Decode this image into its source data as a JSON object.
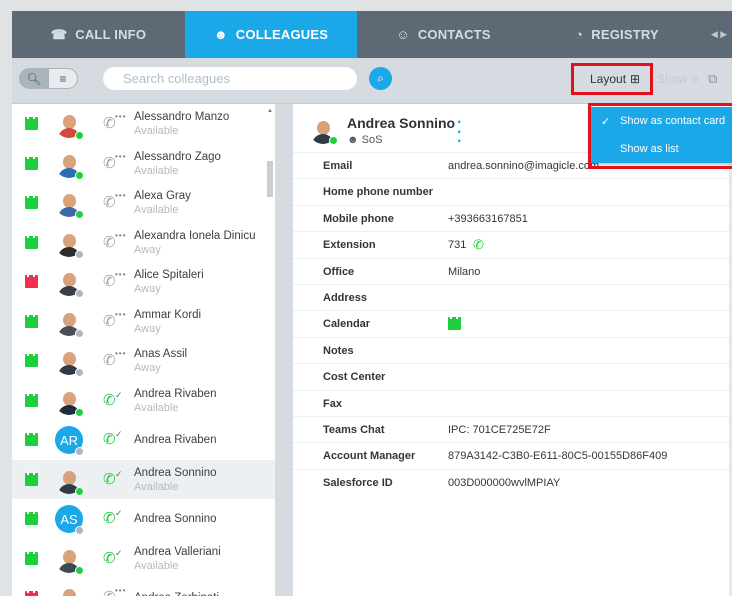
{
  "tabs": [
    {
      "label": "CALL INFO",
      "icon": "call-info-icon"
    },
    {
      "label": "COLLEAGUES",
      "icon": "colleagues-icon"
    },
    {
      "label": "CONTACTS",
      "icon": "contacts-icon"
    },
    {
      "label": "REGISTRY",
      "icon": "registry-icon"
    }
  ],
  "toolbar": {
    "search_placeholder": "Search colleagues",
    "layout_label": "Layout",
    "show_label": "Show"
  },
  "colleagues": [
    {
      "name": "Alessandro Manzo",
      "status": "Available",
      "calendar": "green",
      "presence": "green",
      "phone": "grey",
      "avatar": "photo",
      "shirt": "#d24a3a"
    },
    {
      "name": "Alessandro Zago",
      "status": "Available",
      "calendar": "green",
      "presence": "green",
      "phone": "grey",
      "avatar": "photo",
      "shirt": "#2a6fb2"
    },
    {
      "name": "Alexa Gray",
      "status": "Available",
      "calendar": "green",
      "presence": "green",
      "phone": "grey",
      "avatar": "photo",
      "shirt": "#3c6aa8"
    },
    {
      "name": "Alexandra Ionela Dinicu",
      "status": "Away",
      "calendar": "green",
      "presence": "grey",
      "phone": "grey",
      "avatar": "photo",
      "shirt": "#2c2c2c"
    },
    {
      "name": "Alice Spitaleri",
      "status": "Away",
      "calendar": "red",
      "presence": "grey",
      "phone": "grey",
      "avatar": "photo",
      "shirt": "#3a3f46"
    },
    {
      "name": "Ammar Kordi",
      "status": "Away",
      "calendar": "green",
      "presence": "grey",
      "phone": "grey",
      "avatar": "photo",
      "shirt": "#4b4f55"
    },
    {
      "name": "Anas Assil",
      "status": "Away",
      "calendar": "green",
      "presence": "grey",
      "phone": "grey",
      "avatar": "photo",
      "shirt": "#2d3a4a"
    },
    {
      "name": "Andrea Rivaben",
      "status": "Available",
      "calendar": "green",
      "presence": "green",
      "phone": "green",
      "avatar": "photo",
      "shirt": "#1e2c3c"
    },
    {
      "name": "Andrea Rivaben",
      "status": "",
      "calendar": "green",
      "presence": "grey",
      "phone": "green",
      "avatar": "AR"
    },
    {
      "name": "Andrea Sonnino",
      "status": "Available",
      "calendar": "green",
      "presence": "green",
      "phone": "green",
      "avatar": "photo",
      "shirt": "#2f3b46",
      "selected": true
    },
    {
      "name": "Andrea Sonnino",
      "status": "",
      "calendar": "green",
      "presence": "grey",
      "phone": "green",
      "avatar": "AS"
    },
    {
      "name": "Andrea Valleriani",
      "status": "Available",
      "calendar": "green",
      "presence": "green",
      "phone": "green",
      "avatar": "photo",
      "shirt": "#3b4a57"
    },
    {
      "name": "Andrea Zerbinati",
      "status": "",
      "calendar": "red",
      "presence": "grey",
      "phone": "grey",
      "avatar": "photo",
      "shirt": "#4a4f55"
    }
  ],
  "detail": {
    "name": "Andrea Sonnino",
    "group": "SoS",
    "fields": [
      {
        "label": "Email",
        "value": "andrea.sonnino@imagicle.com"
      },
      {
        "label": "Home phone number",
        "value": ""
      },
      {
        "label": "Mobile phone",
        "value": "+393663167851"
      },
      {
        "label": "Extension",
        "value": "731",
        "phone_icon": true
      },
      {
        "label": "Office",
        "value": "Milano"
      },
      {
        "label": "Address",
        "value": ""
      },
      {
        "label": "Calendar",
        "value": "",
        "calendar_icon": true
      },
      {
        "label": "Notes",
        "value": ""
      },
      {
        "label": "Cost Center",
        "value": ""
      },
      {
        "label": "Fax",
        "value": ""
      },
      {
        "label": "Teams Chat",
        "value": "IPC: 701CE725E72F"
      },
      {
        "label": "Account Manager",
        "value": "879A3142-C3B0-E611-80C5-00155D86F409"
      },
      {
        "label": "Salesforce ID",
        "value": "003D000000wvlMPIAY"
      }
    ]
  },
  "layout_menu": {
    "items": [
      {
        "label": "Show as contact card",
        "checked": true
      },
      {
        "label": "Show as list",
        "checked": false
      }
    ]
  },
  "colors": {
    "accent": "#1aa8e8",
    "tabbar": "#5d6a75",
    "available": "#20cf40",
    "away": "#b0b6bb",
    "highlight": "#e3111b"
  }
}
